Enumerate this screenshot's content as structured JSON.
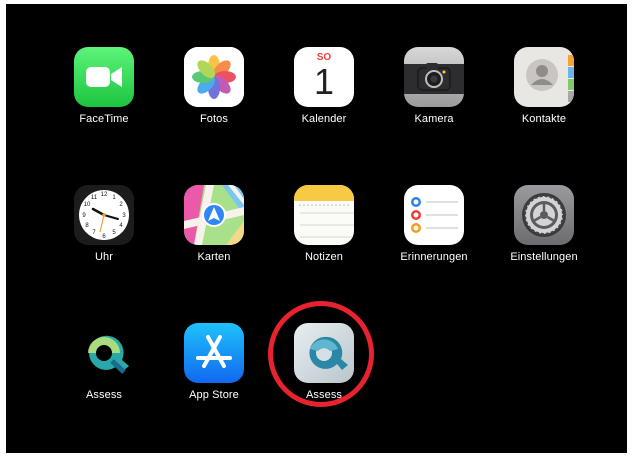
{
  "apps": [
    {
      "label": "FaceTime",
      "icon": "facetime-icon"
    },
    {
      "label": "Fotos",
      "icon": "photos-icon"
    },
    {
      "label": "Kalender",
      "icon": "calendar-icon",
      "weekday": "SO",
      "day": "1"
    },
    {
      "label": "Kamera",
      "icon": "camera-icon"
    },
    {
      "label": "Kontakte",
      "icon": "contacts-icon"
    },
    {
      "label": "Uhr",
      "icon": "clock-icon"
    },
    {
      "label": "Karten",
      "icon": "maps-icon"
    },
    {
      "label": "Notizen",
      "icon": "notes-icon"
    },
    {
      "label": "Erinnerungen",
      "icon": "reminders-icon"
    },
    {
      "label": "Einstellungen",
      "icon": "settings-icon"
    },
    {
      "label": "Assess",
      "icon": "assess-icon"
    },
    {
      "label": "App Store",
      "icon": "app-store-icon"
    },
    {
      "label": "Assess",
      "icon": "assess-icon",
      "highlighted": true
    }
  ],
  "colors": {
    "background": "#000000",
    "highlight": "#e8232f",
    "facetime": "#2fd158",
    "appstore": "#1a8cff",
    "assess_teal": "#2aa8a8"
  }
}
